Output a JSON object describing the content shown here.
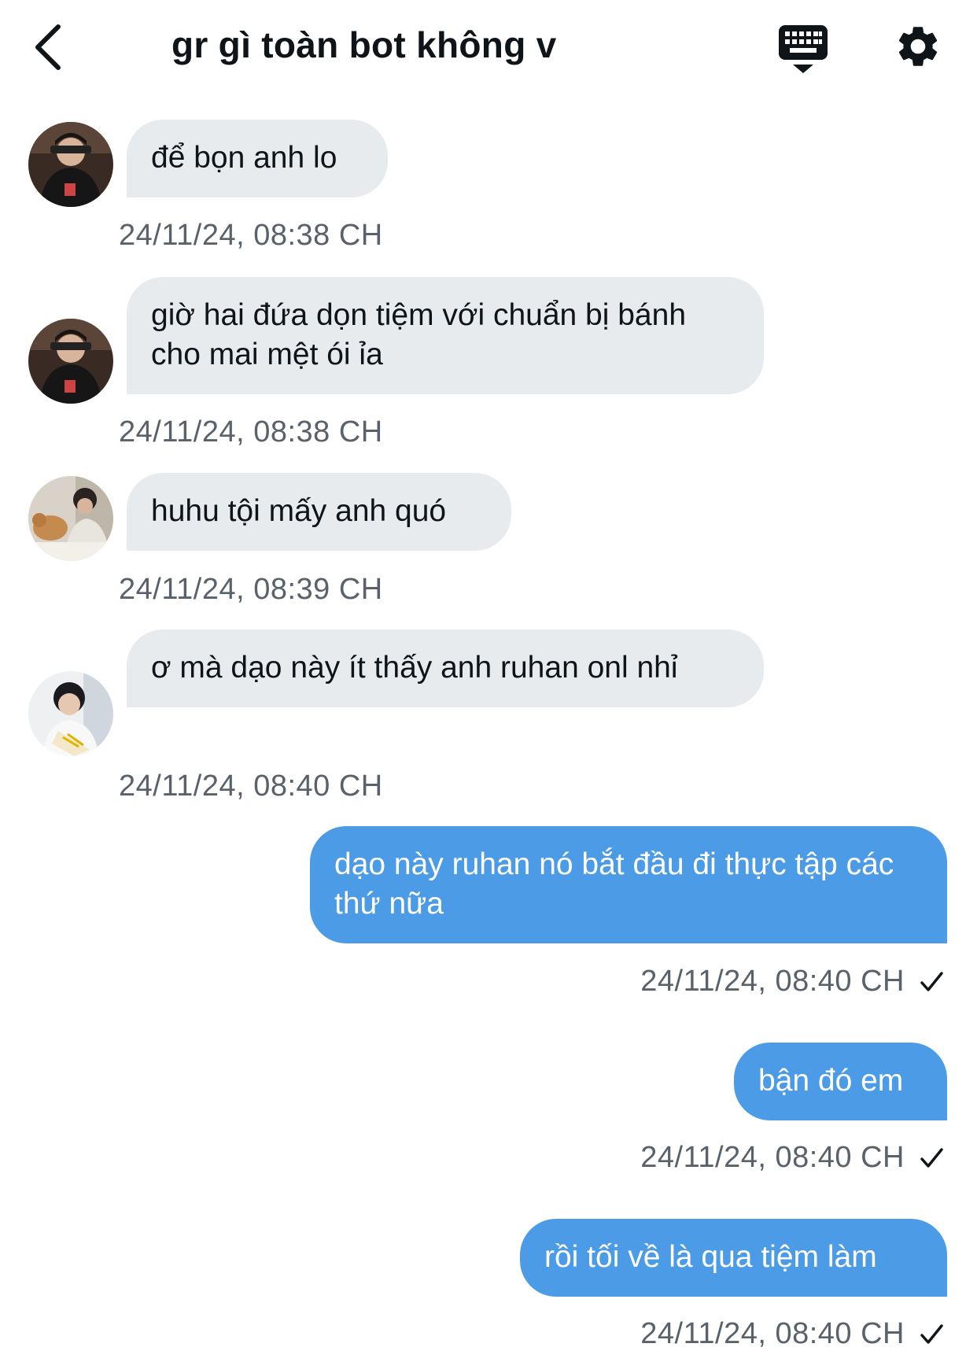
{
  "header": {
    "title": "gr gì toàn bot không v",
    "back_icon": "chevron-left-icon",
    "keyboard_icon": "keyboard-dropdown-icon",
    "settings_icon": "gear-icon"
  },
  "messages": [
    {
      "direction": "in",
      "text": "để bọn anh lo",
      "timestamp": "24/11/24, 08:38 CH",
      "avatar": "avatar-dark-jacket"
    },
    {
      "direction": "in",
      "text": "giờ hai đứa dọn tiệm với chuẩn bị bánh cho mai mệt ói ỉa",
      "timestamp": "24/11/24, 08:38 CH",
      "avatar": "avatar-dark-jacket"
    },
    {
      "direction": "in",
      "text": "huhu tội mấy anh quó",
      "timestamp": "24/11/24, 08:39 CH",
      "avatar": "avatar-with-cat"
    },
    {
      "direction": "in",
      "text": "ơ mà dạo này ít thấy anh ruhan onl nhỉ",
      "timestamp": "24/11/24, 08:40 CH",
      "avatar": "avatar-bouquet"
    },
    {
      "direction": "out",
      "text": "dạo này ruhan nó bắt đầu đi thực tập các thứ nữa",
      "timestamp": "24/11/24, 08:40 CH",
      "status": "sent"
    },
    {
      "direction": "out",
      "text": "bận đó em",
      "timestamp": "24/11/24, 08:40 CH",
      "status": "sent"
    },
    {
      "direction": "out",
      "text": "rồi tối về là qua tiệm làm",
      "timestamp": "24/11/24, 08:40 CH",
      "status": "sent"
    }
  ],
  "colors": {
    "incoming_bubble": "#e8ebee",
    "outgoing_bubble": "#4c9be6",
    "timestamp": "#59626b",
    "text": "#0f1419"
  }
}
